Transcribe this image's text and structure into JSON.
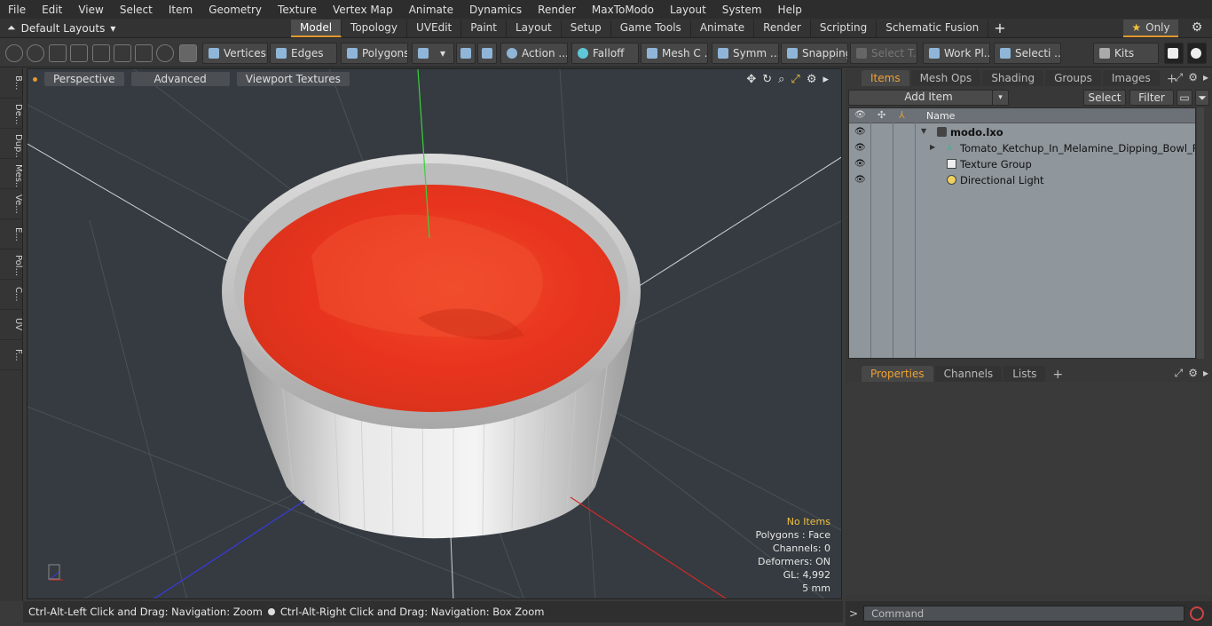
{
  "menu": [
    "File",
    "Edit",
    "View",
    "Select",
    "Item",
    "Geometry",
    "Texture",
    "Vertex Map",
    "Animate",
    "Dynamics",
    "Render",
    "MaxToModo",
    "Layout",
    "System",
    "Help"
  ],
  "layouts": {
    "label": "Default Layouts"
  },
  "tabs": [
    "Model",
    "Topology",
    "UVEdit",
    "Paint",
    "Layout",
    "Setup",
    "Game Tools",
    "Animate",
    "Render",
    "Scripting",
    "Schematic Fusion"
  ],
  "active_tab": "Model",
  "only_label": "Only",
  "toolbar": {
    "vertices": "Vertices",
    "edges": "Edges",
    "polygons": "Polygons",
    "action": "Action ...",
    "falloff": "Falloff",
    "mesh": "Mesh C ...",
    "symm": "Symm ...",
    "snapping": "Snapping",
    "select_t": "Select T...",
    "workpl": "Work Pl...",
    "selecti": "Selecti ...",
    "kits": "Kits"
  },
  "left_strip": [
    "B...",
    "De...",
    "Dup...",
    "Mes...",
    "Ve...",
    "E...",
    "Pol...",
    "C...",
    "UV",
    "F..."
  ],
  "viewport": {
    "perspective": "Perspective",
    "advanced": "Advanced",
    "textures": "Viewport Textures",
    "info": {
      "items": "No Items",
      "polygons": "Polygons : Face",
      "channels": "Channels: 0",
      "deformers": "Deformers: ON",
      "gl": "GL: 4,992",
      "unit": "5 mm"
    }
  },
  "status": {
    "left": "Ctrl-Alt-Left Click and Drag: Navigation: Zoom",
    "right": "Ctrl-Alt-Right Click and Drag: Navigation: Box Zoom"
  },
  "items_panel": {
    "tabs": [
      "Items",
      "Mesh Ops",
      "Shading",
      "Groups",
      "Images"
    ],
    "active": "Items",
    "add_item": "Add Item",
    "select": "Select",
    "filter": "Filter",
    "name_col": "Name",
    "rows": [
      {
        "label": "modo.lxo"
      },
      {
        "label": "Tomato_Ketchup_In_Melamine_Dipping_Bowl_Roun ..."
      },
      {
        "label": "Texture Group"
      },
      {
        "label": "Directional Light"
      }
    ]
  },
  "props_panel": {
    "tabs": [
      "Properties",
      "Channels",
      "Lists"
    ],
    "active": "Properties"
  },
  "command": {
    "placeholder": "Command"
  },
  "colors": {
    "accent": "#e29a31",
    "ketchup": "#e8341e",
    "bowl": "#e6e6e6"
  }
}
